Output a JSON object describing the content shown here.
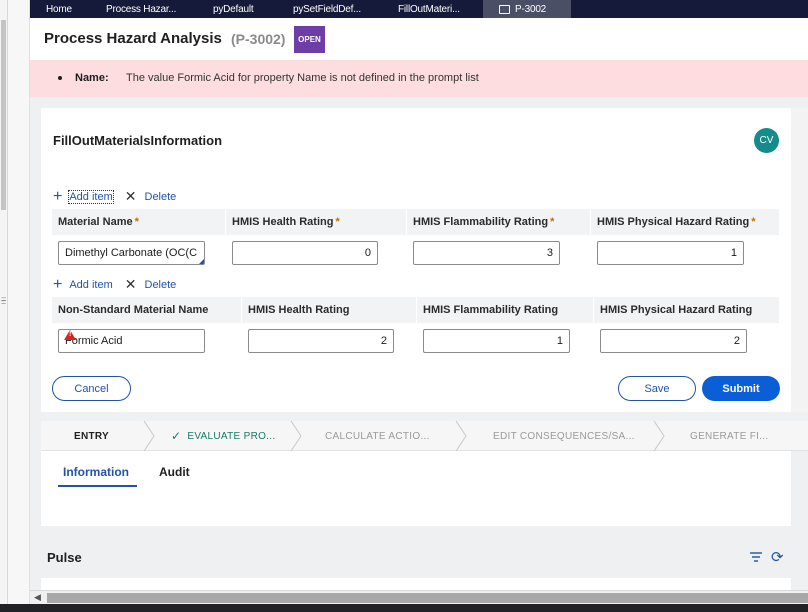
{
  "tabs": [
    {
      "label": "Home"
    },
    {
      "label": "Process Hazar..."
    },
    {
      "label": "pyDefault"
    },
    {
      "label": "pySetFieldDef..."
    },
    {
      "label": "FillOutMateri..."
    },
    {
      "label": "P-3002"
    }
  ],
  "header": {
    "title": "Process Hazard Analysis",
    "case_id": "(P-3002)",
    "status_badge": "OPEN"
  },
  "error": {
    "label": "Name:",
    "message": "The value Formic Acid for property Name is not defined in the prompt list"
  },
  "form": {
    "title": "FillOutMaterialsInformation",
    "avatar_initials": "CV",
    "standard": {
      "add_label": "Add item",
      "delete_label": "Delete",
      "columns": [
        "Material Name",
        "HMIS Health Rating",
        "HMIS Flammability Rating",
        "HMIS Physical Hazard Rating"
      ],
      "row": {
        "material_name": "Dimethyl Carbonate (OC(C",
        "health": "0",
        "flammability": "3",
        "physical": "1"
      }
    },
    "nonstandard": {
      "add_label": "Add item",
      "delete_label": "Delete",
      "columns": [
        "Non-Standard Material Name",
        "HMIS Health Rating",
        "HMIS Flammability Rating",
        "HMIS Physical Hazard Rating"
      ],
      "row": {
        "material_name": "Formic Acid",
        "health": "2",
        "flammability": "1",
        "physical": "2"
      }
    },
    "buttons": {
      "cancel": "Cancel",
      "save": "Save",
      "submit": "Submit"
    }
  },
  "stages": [
    {
      "label": "ENTRY",
      "state": "active"
    },
    {
      "label": "EVALUATE PRO...",
      "state": "done"
    },
    {
      "label": "CALCULATE ACTIO...",
      "state": "pending"
    },
    {
      "label": "EDIT CONSEQUENCES/SA...",
      "state": "pending"
    },
    {
      "label": "GENERATE FI...",
      "state": "pending"
    }
  ],
  "panel_tabs": [
    {
      "label": "Information"
    },
    {
      "label": "Audit"
    }
  ],
  "pulse": {
    "title": "Pulse"
  },
  "colors": {
    "nav": "#15193a",
    "accent": "#2154a6",
    "primary": "#0b5fd6",
    "error_bg": "#fddde0",
    "badge": "#6d3ea6",
    "avatar": "#148c8c",
    "required": "#c96b00"
  }
}
